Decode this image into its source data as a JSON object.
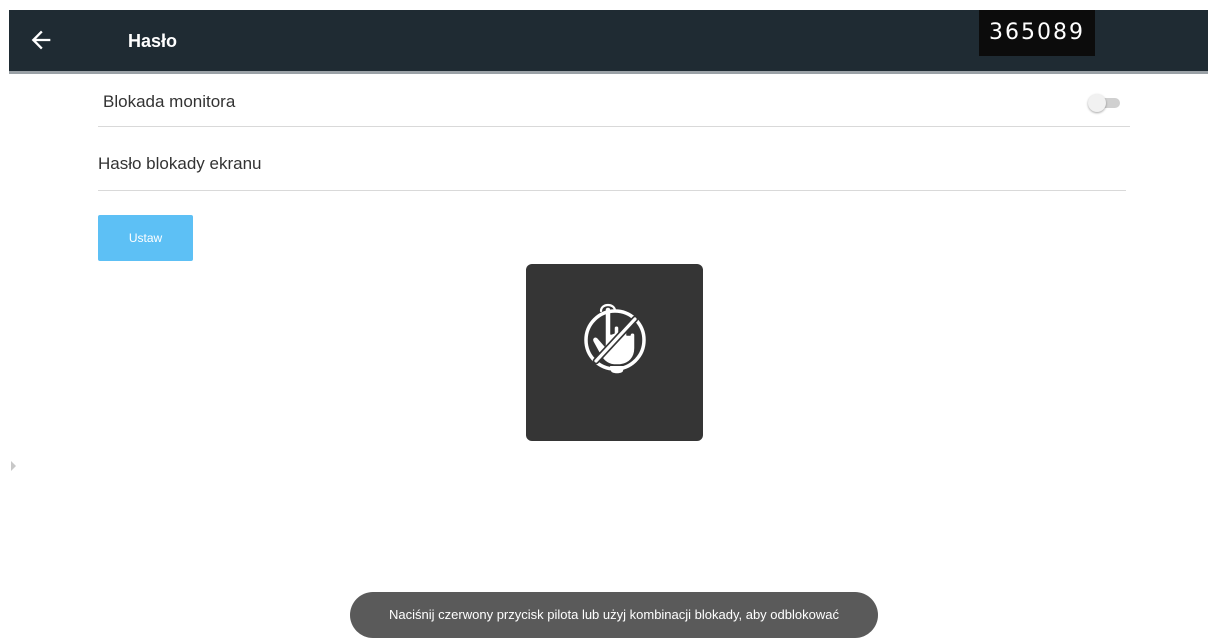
{
  "header": {
    "title": "Hasło",
    "code": "365089",
    "back_icon": "arrow-left-icon",
    "background": "#1f2b33"
  },
  "settings": {
    "monitor_lock": {
      "label": "Blokada monitora",
      "enabled": false
    },
    "screen_lock_password": {
      "label": "Hasło blokady ekranu"
    },
    "set_button": {
      "label": "Ustaw",
      "color": "#5dc0f5"
    }
  },
  "overlay": {
    "icon": "touch-disabled-icon",
    "background": "#353535"
  },
  "side_handle": {
    "icon": "triangle-right-icon"
  },
  "toast": {
    "message": "Naciśnij czerwony przycisk pilota lub użyj kombinacji blokady, aby odblokować"
  }
}
